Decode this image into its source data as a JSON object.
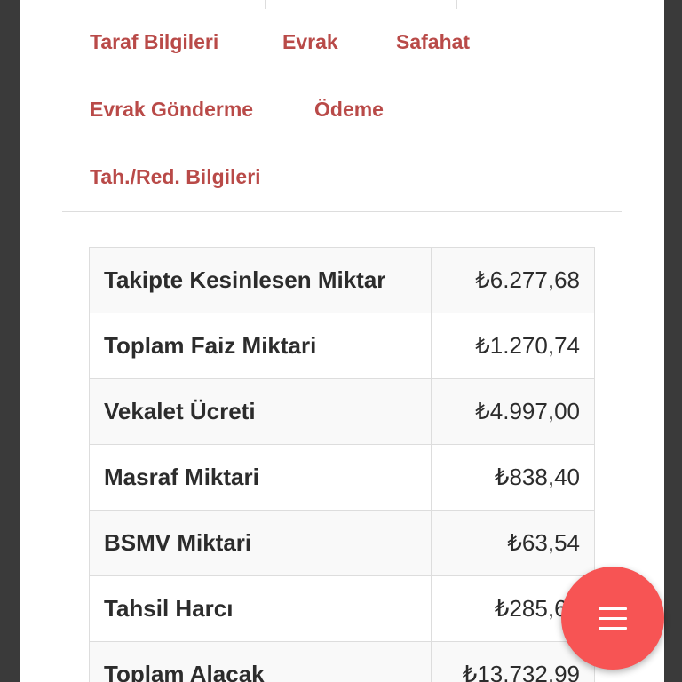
{
  "nav": {
    "tabs": [
      {
        "label": "Taraf Bilgileri"
      },
      {
        "label": "Evrak"
      },
      {
        "label": "Safahat"
      },
      {
        "label": "Evrak Gönderme"
      },
      {
        "label": "Ödeme"
      },
      {
        "label": "Tah./Red. Bilgileri"
      }
    ]
  },
  "summary": {
    "rows": [
      {
        "label": "Takipte Kesinlesen Miktar",
        "value": "₺6.277,68"
      },
      {
        "label": "Toplam Faiz Miktari",
        "value": "₺1.270,74"
      },
      {
        "label": "Vekalet Ücreti",
        "value": "₺4.997,00"
      },
      {
        "label": "Masraf Miktari",
        "value": "₺838,40"
      },
      {
        "label": "BSMV Miktari",
        "value": "₺63,54"
      },
      {
        "label": "Tahsil Harcı",
        "value": "₺285,63"
      },
      {
        "label": "Toplam Alacak",
        "value": "₺13.732,99"
      }
    ]
  },
  "fab": {
    "icon": "menu-icon"
  },
  "colors": {
    "link": "#b94a48",
    "fab": "#f75454",
    "text": "#2c2c2c"
  }
}
